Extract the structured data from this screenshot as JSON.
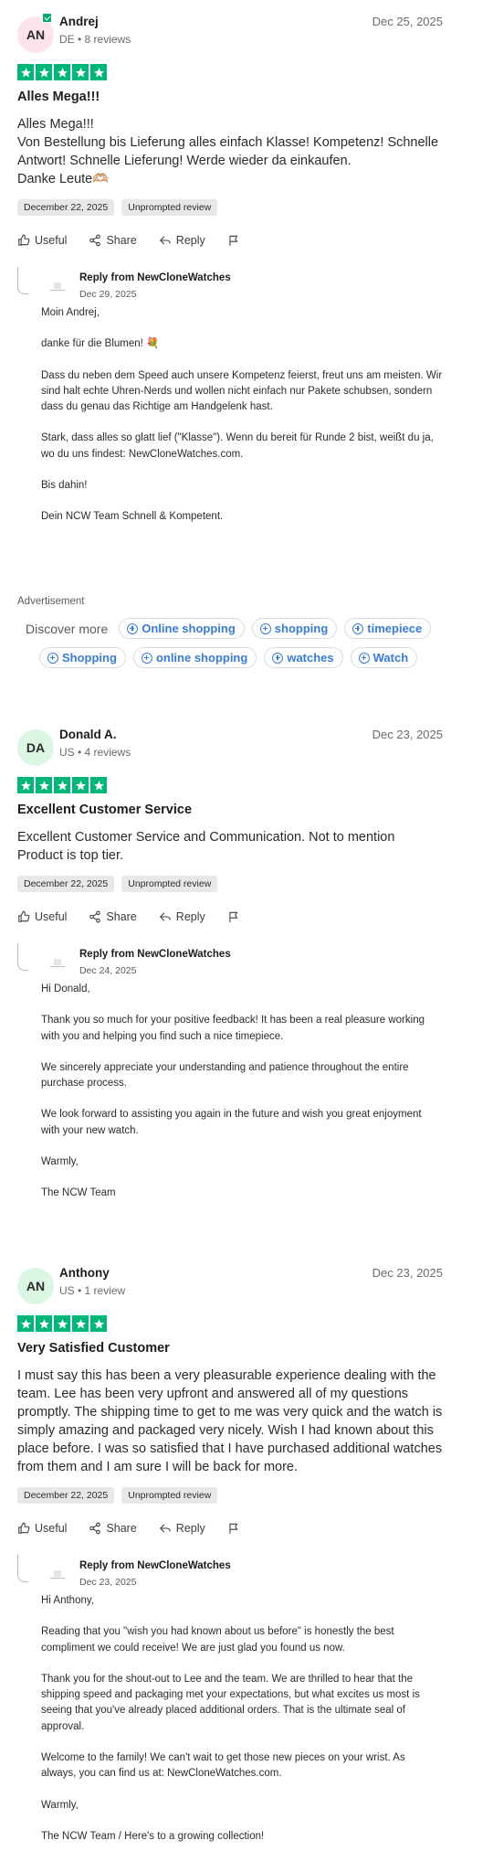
{
  "reviews": [
    {
      "avatar_initials": "AN",
      "avatar_bg": "#fde4ea",
      "verified": true,
      "name": "Andrej",
      "meta": "DE • 8 reviews",
      "date": "Dec 25, 2025",
      "rating": 5,
      "title": "Alles Mega!!!",
      "body": "Alles Mega!!!\nVon Bestellung bis Lieferung alles einfach Klasse! Kompetenz! Schnelle Antwort! Schnelle Lieferung! Werde wieder da einkaufen.\nDanke Leute🫶🏼",
      "experience_date": "December 22, 2025",
      "unprompted_label": "Unprompted review",
      "actions": {
        "useful": "Useful",
        "share": "Share",
        "reply": "Reply"
      },
      "reply": {
        "from": "Reply from NewCloneWatches",
        "date": "Dec 29, 2025",
        "paragraphs": [
          "Moin Andrej,",
          "danke für die Blumen! 💐",
          "Dass du neben dem Speed auch unsere Kompetenz feierst, freut uns am meisten. Wir sind halt echte Uhren-Nerds und wollen nicht einfach nur Pakete schubsen, sondern dass du genau das Richtige am Handgelenk hast.",
          "Stark, dass alles so glatt lief (\"Klasse\"). Wenn du bereit für Runde 2 bist, weißt du ja, wo du uns findest: NewCloneWatches.com.",
          "Bis dahin!",
          "Dein NCW Team Schnell & Kompetent."
        ]
      }
    },
    {
      "avatar_initials": "DA",
      "avatar_bg": "#dcf6e4",
      "verified": false,
      "name": "Donald A.",
      "meta": "US • 4 reviews",
      "date": "Dec 23, 2025",
      "rating": 5,
      "title": "Excellent Customer Service",
      "body": "Excellent Customer Service and Communication. Not to mention Product is top tier.",
      "experience_date": "December 22, 2025",
      "unprompted_label": "Unprompted review",
      "actions": {
        "useful": "Useful",
        "share": "Share",
        "reply": "Reply"
      },
      "reply": {
        "from": "Reply from NewCloneWatches",
        "date": "Dec 24, 2025",
        "paragraphs": [
          "Hi Donald,",
          "Thank you so much for your positive feedback! It has been a real pleasure working with you and helping you find such a nice timepiece.",
          "We sincerely appreciate your understanding and patience throughout the entire purchase process.",
          "We look forward to assisting you again in the future and wish you great enjoyment with your new watch.",
          "Warmly,",
          "The NCW Team"
        ]
      }
    },
    {
      "avatar_initials": "AN",
      "avatar_bg": "#dcf6e4",
      "verified": false,
      "name": "Anthony",
      "meta": "US • 1 review",
      "date": "Dec 23, 2025",
      "rating": 5,
      "title": "Very Satisfied Customer",
      "body": "I must say this has been a very pleasurable experience dealing with the team. Lee has been very upfront and answered all of my questions promptly. The shipping time to get to me was very quick and the watch is simply amazing and packaged very nicely. Wish I had known about this place before. I was so satisfied that I have purchased additional watches from them and I am sure I will be back for more.",
      "experience_date": "December 22, 2025",
      "unprompted_label": "Unprompted review",
      "actions": {
        "useful": "Useful",
        "share": "Share",
        "reply": "Reply"
      },
      "reply": {
        "from": "Reply from NewCloneWatches",
        "date": "Dec 23, 2025",
        "paragraphs": [
          "Hi Anthony,",
          "Reading that you \"wish you had known about us before\" is honestly the best compliment we could receive! We are just glad you found us now.",
          "Thank you for the shout-out to Lee and the team. We are thrilled to hear that the shipping speed and packaging met your expectations, but what excites us most is seeing that you've already placed additional orders. That is the ultimate seal of approval.",
          "Welcome to the family! We can't wait to get those new pieces on your wrist. As always, you can find us at: NewCloneWatches.com.",
          "Warmly,",
          "The NCW Team / Here's to a growing collection!"
        ]
      }
    }
  ],
  "ad": {
    "label": "Advertisement",
    "discover_label": "Discover more",
    "chips_row1": [
      "Online shopping",
      "shopping",
      "timepiece"
    ],
    "chips_row2": [
      "Shopping",
      "online shopping",
      "watches",
      "Watch"
    ]
  },
  "colors": {
    "star_green": "#00b67a",
    "link_blue": "#3a7bd5"
  }
}
